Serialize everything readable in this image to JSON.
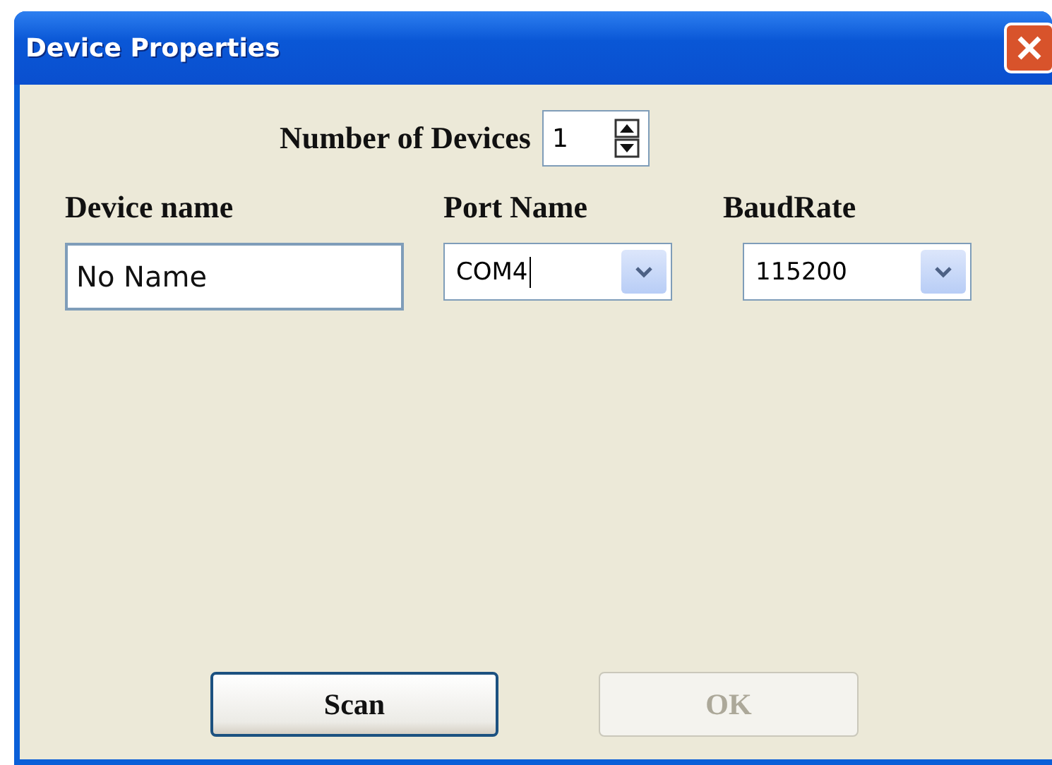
{
  "window": {
    "title": "Device Properties"
  },
  "device_count": {
    "label": "Number of Devices",
    "value": "1"
  },
  "columns": [
    {
      "kind": "text",
      "label": "Device name",
      "value": "No Name"
    },
    {
      "kind": "combo",
      "label": "Port Name",
      "value": "COM4",
      "caret": true
    },
    {
      "kind": "combo",
      "label": "BaudRate",
      "value": "115200",
      "caret": false
    }
  ],
  "buttons": [
    {
      "label": "Scan",
      "disabled": false
    },
    {
      "label": "OK",
      "disabled": true
    }
  ]
}
